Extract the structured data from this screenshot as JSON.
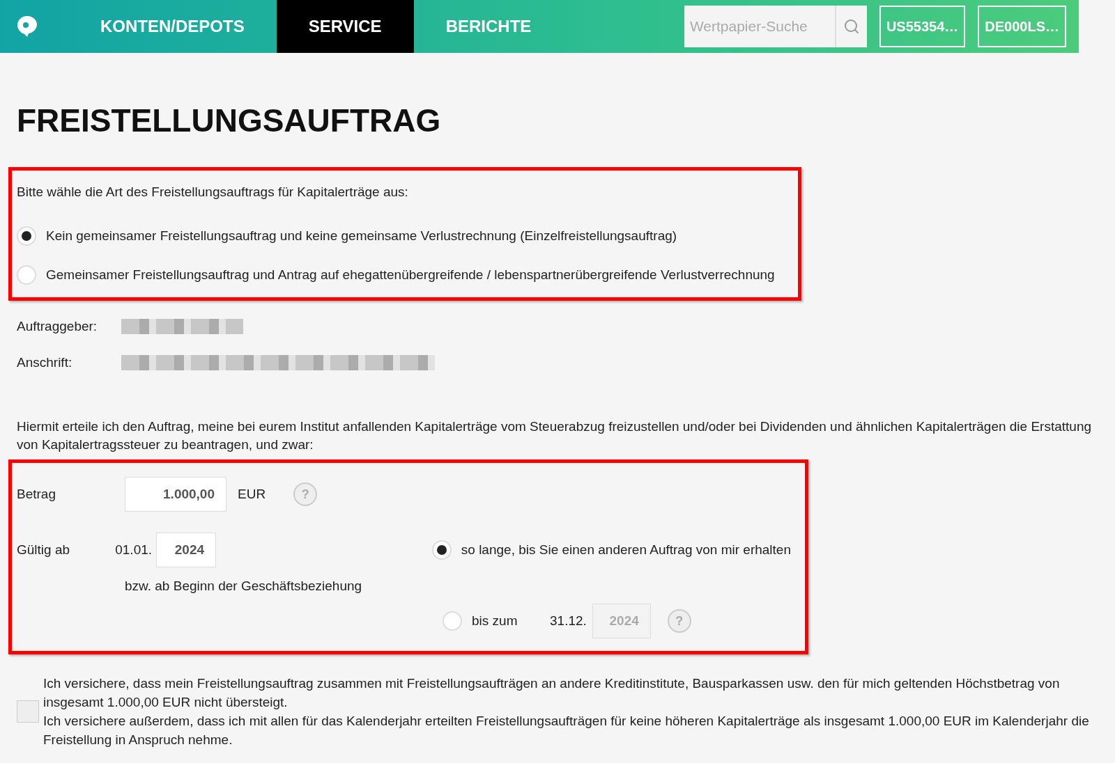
{
  "nav": {
    "tabs": [
      {
        "label": "KONTEN/DEPOTS",
        "selected": false
      },
      {
        "label": "SERVICE",
        "selected": true
      },
      {
        "label": "BERICHTE",
        "selected": false
      }
    ],
    "search": {
      "placeholder": "Wertpapier-Suche"
    },
    "quick_links": [
      "US55354…",
      "DE000LS…"
    ]
  },
  "title": "FREISTELLUNGSAUFTRAG",
  "type_section": {
    "highlighted": true,
    "prompt": "Bitte wähle die Art des Freistellungsauftrags für Kapitalerträge aus:",
    "options": [
      {
        "label": "Kein gemeinsamer Freistellungsauftrag und keine gemeinsame Verlustrechnung (Einzelfreistellungsauftrag)",
        "selected": true
      },
      {
        "label": "Gemeinsamer Freistellungsauftrag und Antrag auf ehegattenübergreifende / lebenspartnerübergreifende Verlustverrechnung",
        "selected": false
      }
    ]
  },
  "holder": [
    {
      "label": "Auftraggeber:"
    },
    {
      "label": "Anschrift:"
    }
  ],
  "intro": "Hiermit erteile ich den Auftrag, meine bei eurem Institut anfallenden Kapitalerträge vom Steuerabzug freizustellen und/oder bei Dividenden und ähnlichen Kapitalerträgen die Erstattung von Kapitalertragssteuer zu beantragen, und zwar:",
  "order_section": {
    "highlighted": true,
    "amount": {
      "label": "Betrag",
      "value": "1.000,00",
      "unit": "EUR",
      "help": "?"
    },
    "valid_from": {
      "label": "Gültig ab",
      "prefix": "01.01.",
      "year": "2024",
      "note": "bzw. ab Beginn der Geschäftsbeziehung"
    },
    "duration": [
      {
        "kind": "open",
        "label": "so lange, bis Sie einen anderen Auftrag von mir erhalten",
        "selected": true
      },
      {
        "kind": "until",
        "label": "bis zum",
        "prefix": "31.12.",
        "year": "2024",
        "disabled": true,
        "help": "?",
        "selected": false
      }
    ]
  },
  "confirmation": {
    "checked": false,
    "lines": [
      "Ich versichere, dass mein Freistellungsauftrag zusammen mit Freistellungsaufträgen an andere Kreditinstitute, Bausparkassen usw. den für mich geltenden Höchstbetrag von insgesamt 1.000,00 EUR nicht übersteigt.",
      "Ich versichere außerdem, dass ich mit allen für das Kalenderjahr erteilten Freistellungsaufträgen für keine höheren Kapitalerträge als insgesamt 1.000,00 EUR im Kalenderjahr die Freistellung in Anspruch nehme."
    ]
  }
}
